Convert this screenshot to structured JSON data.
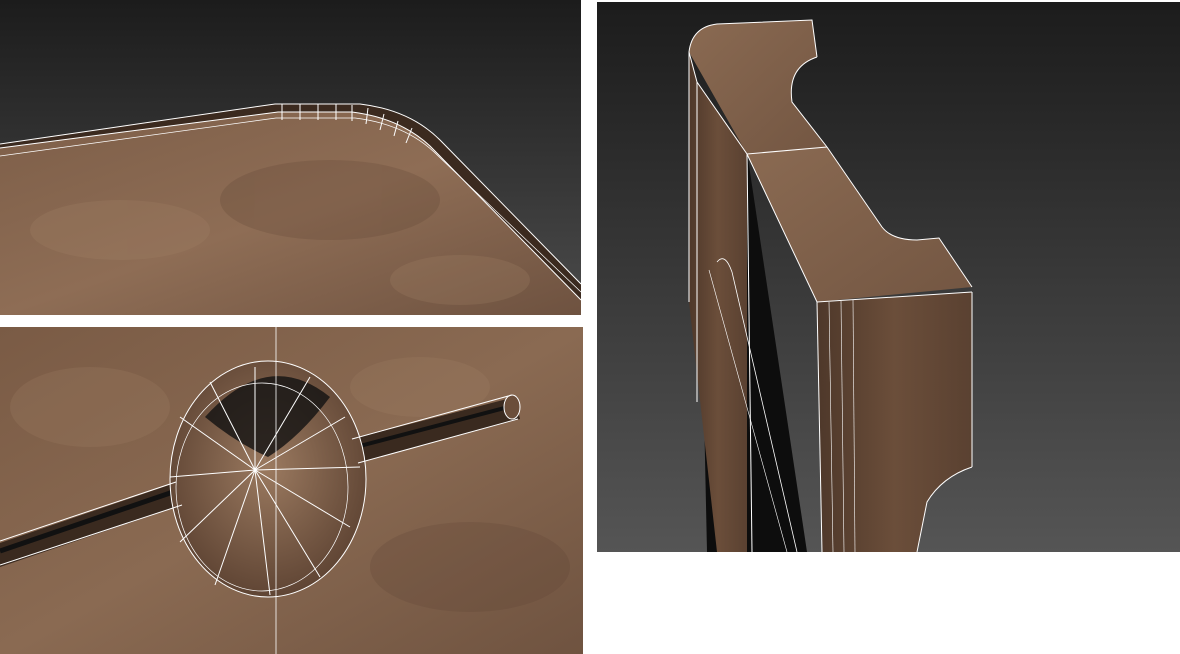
{
  "layout": {
    "panel_count": 3
  },
  "viewports": [
    {
      "id": "top-left",
      "subject": "tabletop-rounded-edge-bevel"
    },
    {
      "id": "bottom-left",
      "subject": "circular-hole-with-channel"
    },
    {
      "id": "right",
      "subject": "board-vertical-notched-edge"
    }
  ],
  "colors": {
    "viewport_bg_top": "#1f1f1f",
    "viewport_bg_bottom": "#4a4a4a",
    "wood_light": "#8a6a52",
    "wood_mid": "#6b4e3a",
    "wood_dark": "#3d2a1e",
    "wire": "#ffffff"
  }
}
